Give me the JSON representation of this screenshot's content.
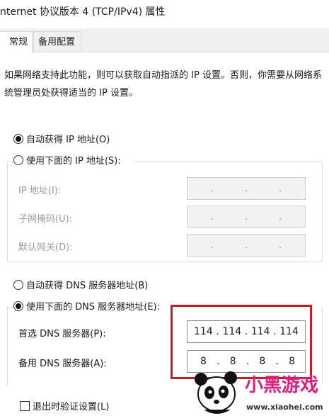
{
  "window": {
    "title": "nternet 协议版本 4 (TCP/IPv4) 属性"
  },
  "tabs": [
    {
      "label": "常规"
    },
    {
      "label": "备用配置"
    }
  ],
  "description": "如果网络支持此功能，则可以获取自动指派的 IP 设置。否则，你需要从网络系统管理员处获得适当的 IP 设置。",
  "ip": {
    "auto_label": "自动获得 IP 地址(O)",
    "manual_label": "使用下面的 IP 地址(S):",
    "auto_selected": true,
    "fields": [
      {
        "label": "IP 地址(I):",
        "segments": [
          "",
          "",
          "",
          ""
        ]
      },
      {
        "label": "子网掩码(U):",
        "segments": [
          "",
          "",
          "",
          ""
        ]
      },
      {
        "label": "默认网关(D):",
        "segments": [
          "",
          "",
          "",
          ""
        ]
      }
    ]
  },
  "dns": {
    "auto_label": "自动获得 DNS 服务器地址(B)",
    "manual_label": "使用下面的 DNS 服务器地址(E):",
    "manual_selected": true,
    "preferred": {
      "label": "首选 DNS 服务器(P):",
      "segments": [
        "114",
        "114",
        "114",
        "114"
      ]
    },
    "alternate": {
      "label": "备用 DNS 服务器(A):",
      "segments": [
        "8",
        "8",
        "8",
        "8"
      ]
    }
  },
  "validate": {
    "label": "退出时验证设置(L)",
    "checked": false
  },
  "colors": {
    "highlight": "#c41e20",
    "watermark": "#e41b7b"
  },
  "watermark": {
    "main": "小黑游戏",
    "url": "www.xiaohei.com"
  }
}
